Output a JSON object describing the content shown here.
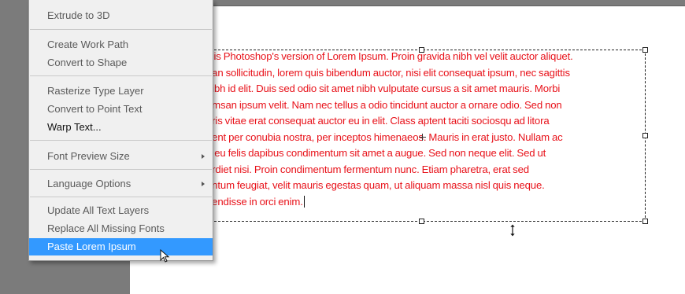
{
  "menu": {
    "groups": [
      {
        "items": [
          {
            "label": "Extrude to 3D",
            "enabled": false
          }
        ]
      },
      {
        "items": [
          {
            "label": "Create Work Path",
            "enabled": false
          },
          {
            "label": "Convert to Shape",
            "enabled": false
          }
        ]
      },
      {
        "items": [
          {
            "label": "Rasterize Type Layer",
            "enabled": false
          },
          {
            "label": "Convert to Point Text",
            "enabled": false
          },
          {
            "label": "Warp Text...",
            "enabled": true
          }
        ]
      },
      {
        "items": [
          {
            "label": "Font Preview Size",
            "enabled": false,
            "submenu": true
          }
        ]
      },
      {
        "items": [
          {
            "label": "Language Options",
            "enabled": false,
            "submenu": true
          }
        ]
      },
      {
        "items": [
          {
            "label": "Update All Text Layers",
            "enabled": false
          },
          {
            "label": "Replace All Missing Fonts",
            "enabled": false
          },
          {
            "label": "Paste Lorem Ipsum",
            "enabled": true,
            "selected": true
          }
        ]
      }
    ],
    "selected_color": "#3399ff"
  },
  "canvas": {
    "text_color": "#e8121a",
    "text_lines": [
      "s is Photoshop's version  of Lorem Ipsum. Proin gravida nibh vel velit auctor aliquet.",
      "ean sollicitudin, lorem quis bibendum auctor, nisi elit consequat ipsum, nec sagittis",
      " nibh id elit. Duis sed odio sit amet nibh vulputate cursus a sit amet mauris. Morbi",
      "umsan ipsum velit. Nam nec tellus a odio tincidunt auctor a ornare odio. Sed non",
      "uris vitae erat consequat auctor eu in elit. Class aptent taciti sociosqu ad litora",
      "uent per conubia nostra, per inceptos himenaeos. Mauris in erat justo. Nullam ac",
      "a eu felis dapibus condimentum sit amet a augue. Sed non neque elit. Sed ut",
      "erdiet nisi. Proin condimentum fermentum nunc. Etiam pharetra, erat sed",
      "entum feugiat, velit mauris egestas quam, ut aliquam massa nisl quis neque.",
      "pendisse in orci enim."
    ]
  },
  "colors": {
    "workspace": "#7b7b7b",
    "menu_bg": "#f0f0f0",
    "disabled_text": "#5a5a5a"
  }
}
